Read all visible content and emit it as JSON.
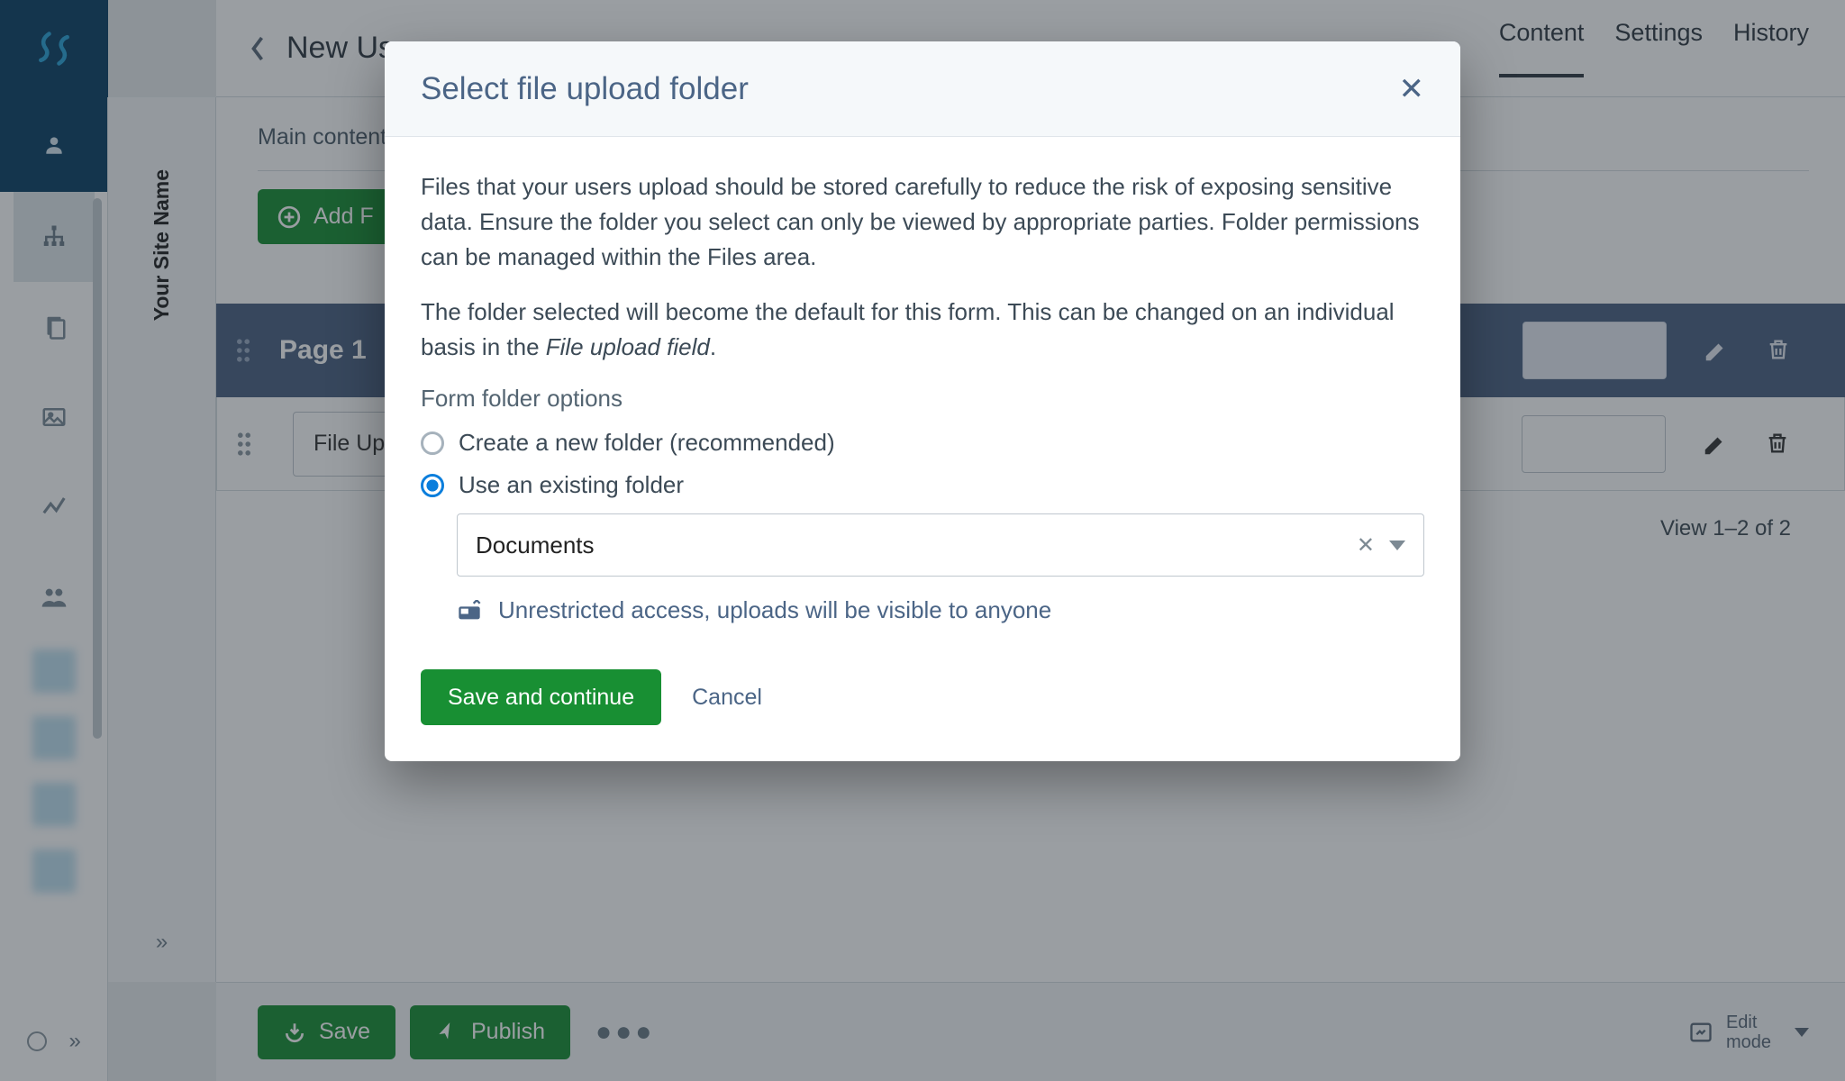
{
  "site_name": "Your Site Name",
  "header": {
    "page_title": "New Us",
    "tabs": {
      "content": "Content",
      "settings": "Settings",
      "history": "History"
    }
  },
  "content": {
    "main_label": "Main content",
    "add_button": "Add F",
    "page_banner_title": "Page 1",
    "field_label": "File Uplo",
    "view_count": "View 1–2 of 2"
  },
  "footer": {
    "save": "Save",
    "publish": "Publish",
    "edit_mode_l1": "Edit",
    "edit_mode_l2": "mode"
  },
  "modal": {
    "title": "Select file upload folder",
    "para1": "Files that your users upload should be stored carefully to reduce the risk of exposing sensitive data. Ensure the folder you select can only be viewed by appropriate parties. Folder permissions can be managed within the Files area.",
    "para2_a": "The folder selected will become the default for this form. This can be changed on an individual basis in the ",
    "para2_em": "File upload field",
    "para2_b": ".",
    "options_label": "Form folder options",
    "radio_new": "Create a new folder (recommended)",
    "radio_existing": "Use an existing folder",
    "selected_folder": "Documents",
    "warning": "Unrestricted access, uploads will be visible to anyone",
    "save_btn": "Save and continue",
    "cancel_btn": "Cancel"
  }
}
